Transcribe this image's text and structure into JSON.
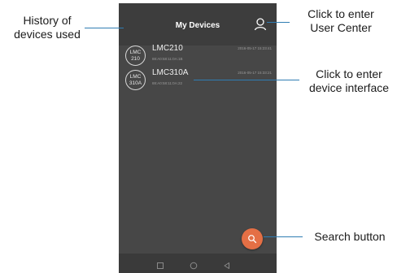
{
  "header": {
    "title": "My Devices",
    "user_icon": "user-icon"
  },
  "devices": [
    {
      "avatar": "LMC\n210",
      "name": "LMC210",
      "timestamp": "2016-05-17 15:23:41",
      "mac": "88:A0:58:11:0A:1B"
    },
    {
      "avatar": "LMC\n310A",
      "name": "LMC310A",
      "timestamp": "2016-05-17 15:33:21",
      "mac": "88:A0:58:11:0A:22"
    }
  ],
  "search": {
    "icon": "search-icon",
    "color": "#e46f45"
  },
  "navbar": {
    "icons": [
      "square-icon",
      "circle-icon",
      "triangle-back-icon"
    ]
  },
  "callouts": {
    "history": "History of\ndevices used",
    "user_center": "Click to enter\nUser Center",
    "device_interface": "Click to enter\ndevice interface",
    "search": "Search button"
  },
  "colors": {
    "screen_bg": "#474747",
    "header_bg": "#3d3d3d",
    "leader_line": "#2f7db3"
  }
}
